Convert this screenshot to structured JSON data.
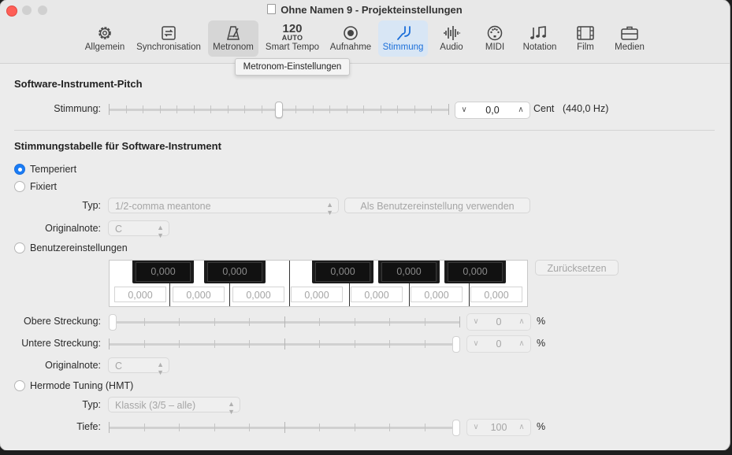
{
  "window": {
    "title": "Ohne Namen 9 - Projekteinstellungen"
  },
  "toolbar": {
    "items": [
      {
        "label": "Allgemein"
      },
      {
        "label": "Synchronisation"
      },
      {
        "label": "Metronom"
      },
      {
        "label": "Smart Tempo",
        "value": "120",
        "sub": "AUTO"
      },
      {
        "label": "Aufnahme"
      },
      {
        "label": "Stimmung"
      },
      {
        "label": "Audio"
      },
      {
        "label": "MIDI"
      },
      {
        "label": "Notation"
      },
      {
        "label": "Film"
      },
      {
        "label": "Medien"
      }
    ],
    "selected": "Stimmung",
    "accent_color": "#1c6fd9",
    "tooltip": "Metronom-Einstellungen"
  },
  "pitch": {
    "heading": "Software-Instrument-Pitch",
    "label": "Stimmung:",
    "value": "0,0",
    "unit": "Cent",
    "hz": "(440,0 Hz)",
    "slider_position": 0.5
  },
  "table": {
    "heading": "Stimmungstabelle für Software-Instrument",
    "temperiert": "Temperiert",
    "fixiert": "Fixiert",
    "type_label": "Typ:",
    "type_value": "1/2-comma meantone",
    "use_button": "Als Benutzereinstellung verwenden",
    "orig_label": "Originalnote:",
    "orig_value": "C",
    "custom": "Benutzereinstellungen",
    "black_keys": [
      "0,000",
      "0,000",
      "0,000",
      "0,000",
      "0,000"
    ],
    "white_keys": [
      "0,000",
      "0,000",
      "0,000",
      "0,000",
      "0,000",
      "0,000",
      "0,000"
    ],
    "reset_button": "Zurücksetzen",
    "upper_label": "Obere Streckung:",
    "upper_value": "0",
    "upper_position": 0.0,
    "lower_label": "Untere Streckung:",
    "lower_value": "0",
    "lower_position": 1.0,
    "percent": "%",
    "orig2_label": "Originalnote:",
    "orig2_value": "C",
    "hmt": "Hermode Tuning (HMT)",
    "hmt_type_label": "Typ:",
    "hmt_type_value": "Klassik (3/5 – alle)",
    "depth_label": "Tiefe:",
    "depth_value": "100",
    "depth_position": 1.0
  }
}
